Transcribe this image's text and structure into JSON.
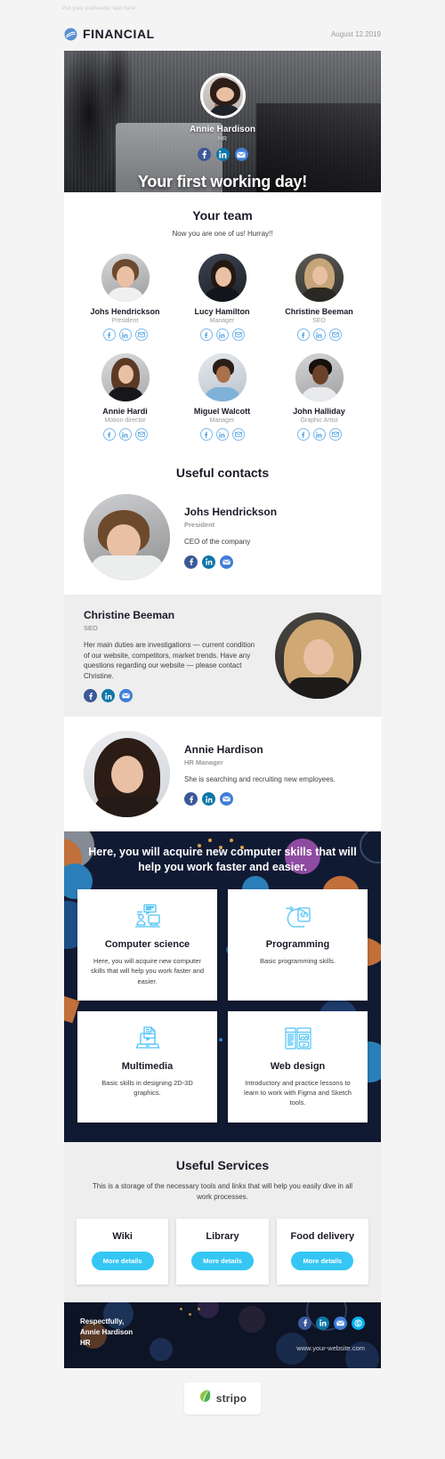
{
  "preheader": "Put your preheader text here",
  "header": {
    "brand": "FINANCIAL",
    "date": "August 12.2019",
    "logo_icon": "financial-swirl-icon"
  },
  "hero": {
    "name": "Annie Hardison",
    "role": "HR",
    "title": "Your first working day!",
    "socials": [
      "facebook-icon",
      "linkedin-icon",
      "email-icon"
    ]
  },
  "team": {
    "title": "Your team",
    "subtitle": "Now you are one of us! Hurray!!",
    "members": [
      {
        "name": "Johs Hendrickson",
        "role": "President"
      },
      {
        "name": "Lucy Hamilton",
        "role": "Manager"
      },
      {
        "name": "Christine Beeman",
        "role": "SEO"
      },
      {
        "name": "Annie Hardi",
        "role": "Motion director"
      },
      {
        "name": "Miguel Walcott",
        "role": "Manager"
      },
      {
        "name": "John Halliday",
        "role": "Graphic Artist"
      }
    ]
  },
  "contacts": {
    "title": "Useful contacts",
    "people": [
      {
        "name": "Johs Hendrickson",
        "role": "President",
        "desc": "CEO of the company"
      },
      {
        "name": "Christine Beeman",
        "role": "SEO",
        "desc": "Her main duties are investigations — current condition of our website, competitors, market trends. Have any questions regarding our website — please contact Christine."
      },
      {
        "name": "Annie Hardison",
        "role": "HR Manager",
        "desc": "She is searching and recruiting new employees."
      }
    ]
  },
  "skills": {
    "heading": "Here, you will acquire new computer skills that will help you work faster and easier.",
    "cards": [
      {
        "icon": "computer-science-icon",
        "title": "Computer science",
        "desc": "Here, you will acquire new computer skills that will help you work faster and easier."
      },
      {
        "icon": "programming-icon",
        "title": "Programming",
        "desc": "Basic programming skills."
      },
      {
        "icon": "multimedia-icon",
        "title": "Multimedia",
        "desc": "Basic skills in designing 2D-3D graphics."
      },
      {
        "icon": "web-design-icon",
        "title": "Web design",
        "desc": "Introductory and practice lessons to learn to work with Figma and Sketch tools."
      }
    ]
  },
  "services": {
    "title": "Useful Services",
    "subtitle": "This is a storage of the necessary tools and links that will help you easily dive in all work processes.",
    "items": [
      {
        "title": "Wiki",
        "button": "More details"
      },
      {
        "title": "Library",
        "button": "More details"
      },
      {
        "title": "Food delivery",
        "button": "More details"
      }
    ]
  },
  "footer": {
    "sign_line1": "Respectfully,",
    "sign_line2": "Annie Hardison",
    "sign_line3": "HR",
    "website": "www.your-website.com",
    "socials": [
      "facebook-icon",
      "linkedin-icon",
      "email-icon",
      "skype-icon"
    ]
  },
  "stripo": {
    "name": "stripo",
    "icon": "stripo-leaf-icon"
  },
  "colors": {
    "accent_blue": "#35c6f4",
    "dark_navy": "#111a33",
    "footer_navy": "#0d1426",
    "facebook": "#3b5998",
    "linkedin": "#0e76a8",
    "email": "#3f7dd8",
    "skype": "#00aff0",
    "icon_line": "#4fc3f7",
    "page_bg": "#f4f4f4",
    "grey_panel": "#eeeeee"
  }
}
